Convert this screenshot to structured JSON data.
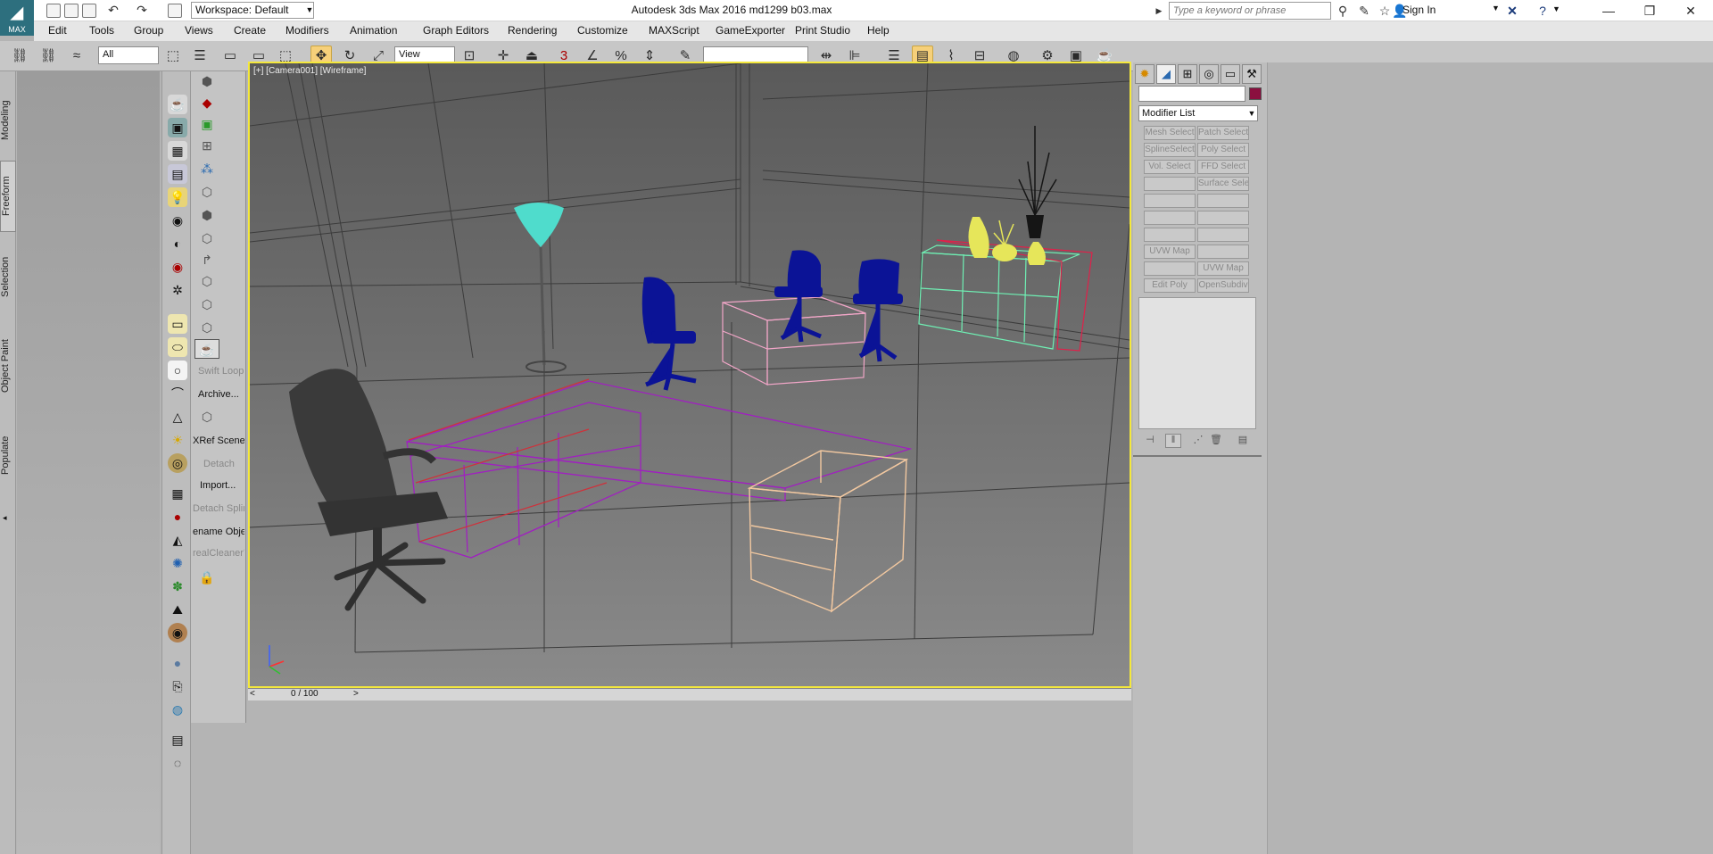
{
  "title_bar": {
    "app_logo_text": "MAX",
    "workspace": "Workspace: Default",
    "window_title": "Autodesk 3ds Max 2016     md1299 b03.max",
    "search_placeholder": "Type a keyword or phrase",
    "sign_in": "Sign In"
  },
  "menu": [
    "Edit",
    "Tools",
    "Group",
    "Views",
    "Create",
    "Modifiers",
    "Animation",
    "Graph Editors",
    "Rendering",
    "Customize",
    "MAXScript",
    "GameExporter",
    "Print Studio",
    "Help"
  ],
  "toolbar": {
    "selection_filter": "All",
    "reference_coord": "View",
    "snap_label": "3",
    "named_selection": ""
  },
  "left_tabs": [
    "Modeling",
    "Freeform",
    "Selection",
    "Object Paint",
    "Populate"
  ],
  "command_column": {
    "items": [
      "Swift Loop",
      "Archive...",
      "XRef Scene...",
      "Detach",
      "Import...",
      "Detach Spline",
      "ename Objects",
      "realCleaner´s"
    ]
  },
  "viewport": {
    "label": "[+] [Camera001] [Wireframe]",
    "colors": {
      "border": "#f4e83c",
      "lamp": "#4fdccc",
      "chair_dark": "#3a3a3a",
      "chair_blue": "#0b1396",
      "desk_purple": "#a020c0",
      "desk_red": "#d0303a",
      "desk_pink": "#f2a6c8",
      "cabinet_peach": "#f2c8a0",
      "shelf_green": "#6ff0b4",
      "shelf_red": "#e0204a",
      "vase_yellow": "#e6e65a",
      "pot_black": "#151515"
    }
  },
  "timeline": {
    "counter": "0 / 100",
    "prev": "<",
    "next": ">"
  },
  "command_panel": {
    "modifier_list": "Modifier List",
    "buttons": [
      [
        "Mesh Select",
        "Patch Select"
      ],
      [
        "SplineSelect",
        "Poly Select"
      ],
      [
        "Vol. Select",
        "FFD Select"
      ],
      [
        "",
        "Surface Select"
      ],
      [
        "",
        ""
      ],
      [
        "",
        ""
      ],
      [
        "",
        ""
      ],
      [
        "UVW Map",
        ""
      ],
      [
        "",
        "UVW Map"
      ],
      [
        "Edit Poly",
        "OpenSubdiv"
      ]
    ],
    "swatch_color": "#8b0f3f"
  }
}
